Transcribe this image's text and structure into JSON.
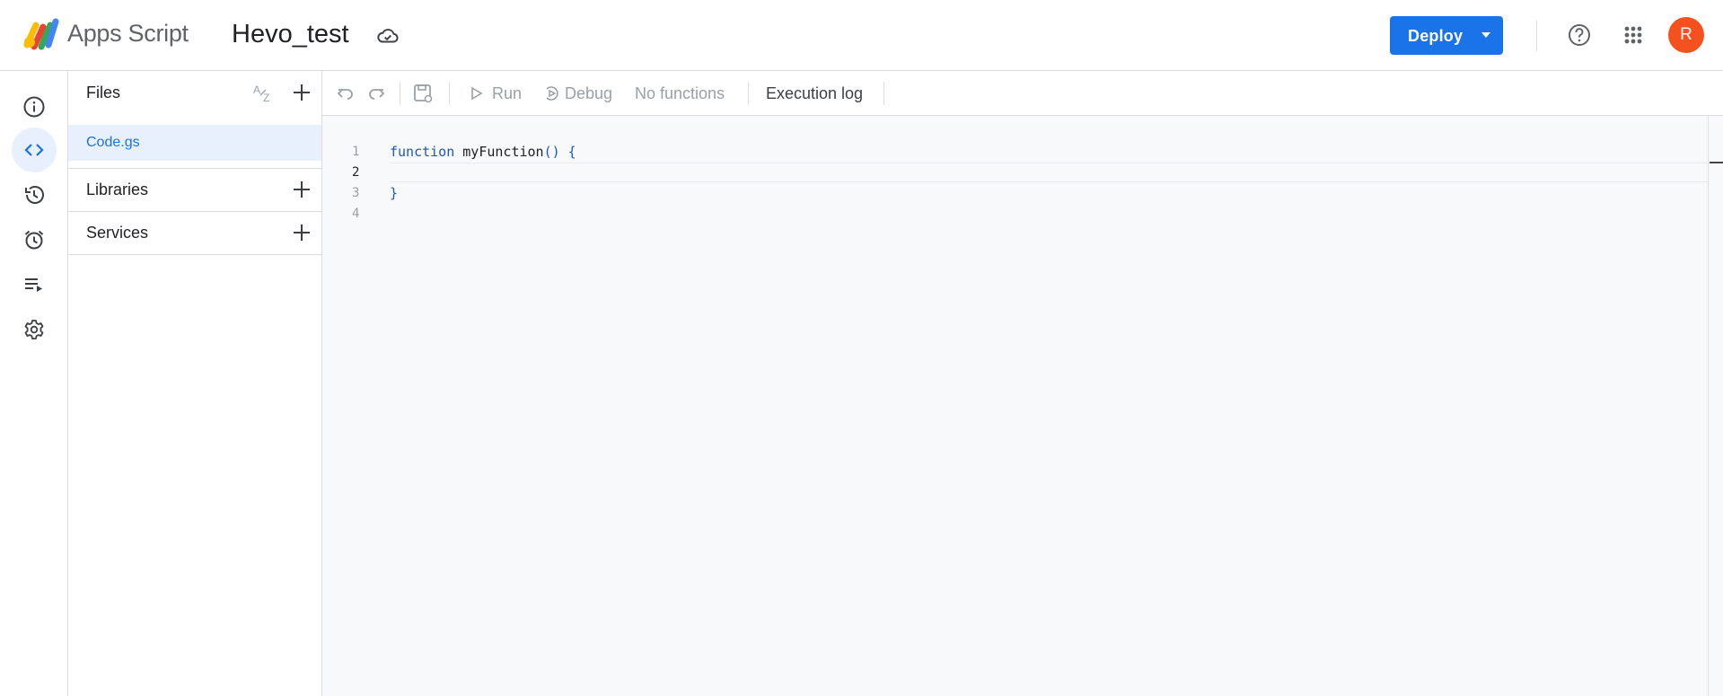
{
  "header": {
    "app_name": "Apps Script",
    "project_title": "Hevo_test",
    "deploy_label": "Deploy",
    "avatar_initial": "R",
    "brand_color": "#1a73e8",
    "avatar_color": "#f4511e"
  },
  "rail": {
    "items": [
      {
        "icon": "info-icon"
      },
      {
        "icon": "code-icon",
        "active": true
      },
      {
        "icon": "history-icon"
      },
      {
        "icon": "alarm-icon"
      },
      {
        "icon": "executions-icon"
      },
      {
        "icon": "settings-icon"
      }
    ]
  },
  "files_panel": {
    "files_title": "Files",
    "files": [
      "Code.gs"
    ],
    "libraries_title": "Libraries",
    "services_title": "Services"
  },
  "toolbar": {
    "run_label": "Run",
    "debug_label": "Debug",
    "function_select": "No functions",
    "execution_log_label": "Execution log"
  },
  "editor": {
    "line_numbers": [
      "1",
      "2",
      "3",
      "4"
    ],
    "current_line": "2",
    "code": {
      "line1_keyword": "function",
      "line1_name": " myFunction",
      "line1_parens": "()",
      "line1_brace": " {",
      "line3_brace": "}"
    }
  }
}
